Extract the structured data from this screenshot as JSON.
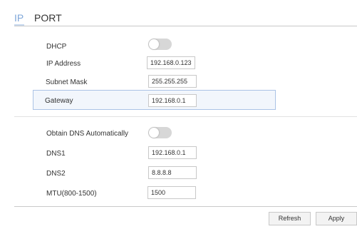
{
  "tabs": [
    {
      "label": "IP",
      "active": true
    },
    {
      "label": "PORT",
      "active": false
    }
  ],
  "form": {
    "dhcp": {
      "label": "DHCP",
      "enabled": false
    },
    "ip_address": {
      "label": "IP Address",
      "value": "192.168.0.123"
    },
    "subnet_mask": {
      "label": "Subnet Mask",
      "value": "255.255.255"
    },
    "gateway": {
      "label": "Gateway",
      "value": "192.168.0.1"
    },
    "obtain_dns": {
      "label": "Obtain DNS Automatically",
      "enabled": false
    },
    "dns1": {
      "label": "DNS1",
      "value": "192.168.0.1"
    },
    "dns2": {
      "label": "DNS2",
      "value": "8.8.8.8"
    },
    "mtu": {
      "label": "MTU(800-1500)",
      "value": "1500"
    }
  },
  "buttons": {
    "refresh": "Refresh",
    "apply": "Apply"
  },
  "colors": {
    "active_tab": "#7fa7d9",
    "gateway_highlight_border": "#aac3e6",
    "gateway_highlight_bg": "#f2f6fc",
    "toggle_off": "#d7d7d7"
  }
}
